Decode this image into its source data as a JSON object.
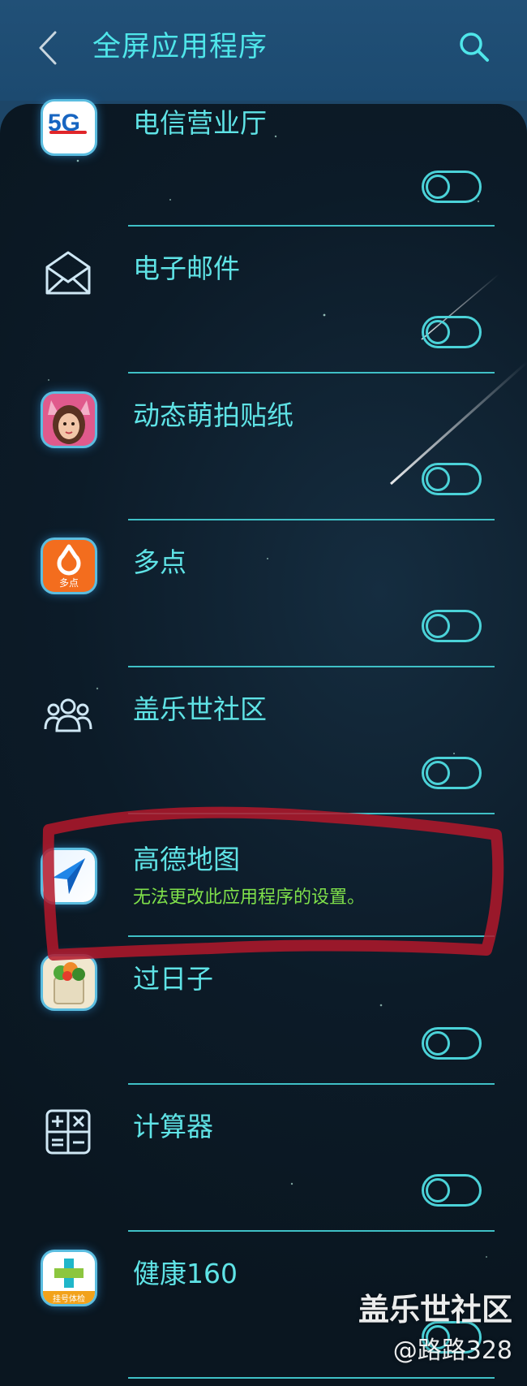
{
  "header": {
    "title": "全屏应用程序",
    "back_icon": "chevron-left-icon",
    "search_icon": "search-icon"
  },
  "colors": {
    "accent": "#4fe6ea",
    "header_bg": "#1d4668",
    "panel_bg": "#0c1b28",
    "divider": "#3fc0c6",
    "warning_text": "#7fe04a",
    "annotation": "#b3182a"
  },
  "apps": [
    {
      "name": "电信营业厅",
      "icon": "telecom-5g-icon",
      "toggle": false
    },
    {
      "name": "电子邮件",
      "icon": "envelope-icon",
      "toggle": false
    },
    {
      "name": "动态萌拍贴纸",
      "icon": "cat-avatar-icon",
      "toggle": false
    },
    {
      "name": "多点",
      "icon": "duodian-icon",
      "icon_text": "多点",
      "toggle": false
    },
    {
      "name": "盖乐世社区",
      "icon": "community-people-icon",
      "toggle": false
    },
    {
      "name": "高德地图",
      "icon": "amap-navigation-icon",
      "subtitle": "无法更改此应用程序的设置。"
    },
    {
      "name": "过日子",
      "icon": "grocery-bag-icon",
      "toggle": false
    },
    {
      "name": "计算器",
      "icon": "calculator-icon",
      "toggle": false
    },
    {
      "name": "健康160",
      "icon": "health-cross-icon",
      "icon_text": "挂号体检",
      "toggle": false
    }
  ],
  "icon_text_5g": "5G",
  "watermark": {
    "line1": "盖乐世社区",
    "line2": "@路路328"
  }
}
